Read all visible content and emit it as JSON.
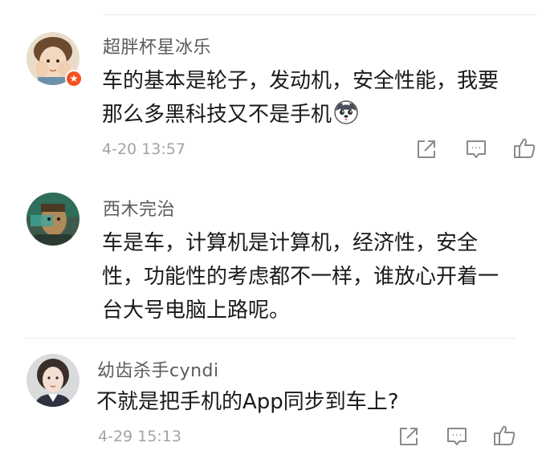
{
  "comments": [
    {
      "username": "超胖杯星冰乐",
      "text_lines": [
        "车的基本是轮子，发动机，安全性能，我要",
        "那么多黑科技又不是手机"
      ],
      "timestamp": "4-20 13:57",
      "verified_badge": "v-star-badge",
      "emoji": "husky-dog-emoji"
    },
    {
      "username": "西木完治",
      "text_lines": [
        "车是车，计算机是计算机，经济性，安全",
        "性，功能性的考虑都不一样，谁放心开着一",
        "台大号电脑上路呢。"
      ]
    },
    {
      "username": "幼齿杀手cyndi",
      "text_lines": [
        "不就是把手机的App同步到车上?"
      ],
      "timestamp": "4-29 15:13"
    }
  ],
  "actions": {
    "share_icon": "share-icon",
    "reply_icon": "comment-icon",
    "like_icon": "thumbs-up-icon"
  },
  "colors": {
    "username": "#5b5b5b",
    "text": "#1a1a1a",
    "timestamp": "#a3a3a3",
    "badge": "#f4511e",
    "icon": "#8a8a8a"
  }
}
